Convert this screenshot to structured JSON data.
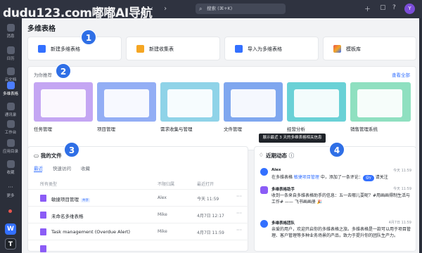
{
  "watermark": "dudu123.com嘟嘟AI导航",
  "search": {
    "placeholder": "搜索 (⌘+K)"
  },
  "avatar": "Y",
  "sidebar": {
    "items": [
      {
        "label": "消息"
      },
      {
        "label": "日历"
      },
      {
        "label": "云文档"
      },
      {
        "label": "多维表格"
      },
      {
        "label": "通讯录"
      },
      {
        "label": "工作台"
      },
      {
        "label": "应用目录"
      },
      {
        "label": "收藏"
      },
      {
        "label": "更多"
      }
    ],
    "bottom": [
      "W",
      "T"
    ]
  },
  "page_title": "多维表格",
  "quick_actions": [
    {
      "label": "新建多维表格",
      "color": "#3370ff"
    },
    {
      "label": "新建收集表",
      "color": "#f5a623"
    },
    {
      "label": "导入为多维表格",
      "color": "#3370ff"
    },
    {
      "label": "模板库",
      "color": "#e8554e"
    }
  ],
  "callouts": [
    "1",
    "2",
    "3",
    "4"
  ],
  "recommend": {
    "title": "为你推荐",
    "view_all": "查看全部",
    "cards": [
      {
        "label": "任务管理",
        "color": "#c4a6f3"
      },
      {
        "label": "项目管理",
        "color": "#93aef5"
      },
      {
        "label": "需求收集与管理",
        "color": "#8fd3e8"
      },
      {
        "label": "文件管理",
        "color": "#7fa7ef"
      },
      {
        "label": "经营分析",
        "color": "#6ad1d6"
      },
      {
        "label": "销售管理系统",
        "color": "#8fe0c0"
      }
    ]
  },
  "tooltip": "展示最近 3 天的多维表格相关信息",
  "files": {
    "title": "我的文件",
    "tabs": [
      "最近",
      "快速访问",
      "收藏"
    ],
    "headers": {
      "type": "所有类型",
      "owner": "不限归属",
      "time": "最近打开"
    },
    "rows": [
      {
        "name": "敏捷项目管理",
        "tag": "共享",
        "owner": "Alex",
        "time": "今天 11:59"
      },
      {
        "name": "未命名多维表格",
        "tag": "",
        "owner": "Mike",
        "time": "4月7日 12:17"
      },
      {
        "name": "Task management (Overdue Alert)",
        "tag": "",
        "owner": "Mike",
        "time": "4月7日 11:59"
      },
      {
        "name": "",
        "tag": "",
        "owner": "",
        "time": ""
      }
    ]
  },
  "news": {
    "title": "近期动态",
    "items": [
      {
        "name": "Alex",
        "date": "今天 11:59",
        "text_a": "在多维表格 ",
        "link": "敏捷项目管理",
        "text_b": " 中，添加了一条评论：",
        "pill": "@y",
        "text_c": " 请关注",
        "color": "#3370ff"
      },
      {
        "name": "多维表格助手",
        "date": "今天 11:59",
        "text_a": "收到一条来自多维表格助手的信息：五一去哪儿耍呢？#用画画得制生活与工作# —— 飞书画画册 🎉",
        "link": "",
        "text_b": "",
        "pill": "",
        "text_c": "",
        "color": "#8b5cf6"
      },
      {
        "name": "多维表格团队",
        "date": "4月7日 11:59",
        "text_a": "亲爱的用户，欢迎开启你的多维表格之旅。多维表格是一款可以用于项目管理、客户管理等多种业务场景的产品，致力于提升你的团队生产力。",
        "link": "",
        "text_b": "",
        "pill": "",
        "text_c": "",
        "color": "#3370ff"
      }
    ]
  }
}
